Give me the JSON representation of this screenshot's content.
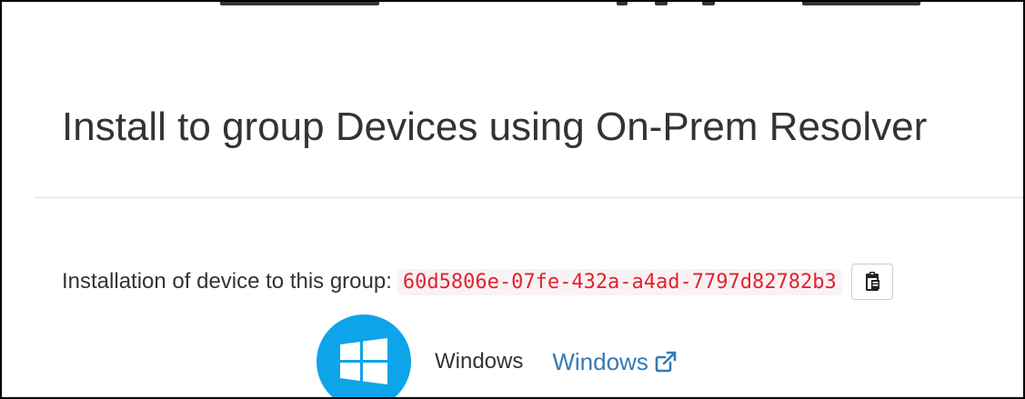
{
  "page": {
    "title": "Install to group Devices using On-Prem Resolver"
  },
  "install": {
    "label": "Installation of device to this group:",
    "group_id": "60d5806e-07fe-432a-a4ad-7797d82782b3",
    "copy_icon": "clipboard-paste-icon"
  },
  "platforms": [
    {
      "name": "Windows",
      "link_label": "Windows",
      "logo_icon": "windows-logo-icon",
      "external_icon": "external-link-icon"
    }
  ],
  "colors": {
    "text": "#333333",
    "code_text": "#e2232f",
    "code_bg": "#f9f2f4",
    "link": "#337ab7",
    "windows_logo": "#0ea4e9",
    "divider": "#dddddd"
  }
}
